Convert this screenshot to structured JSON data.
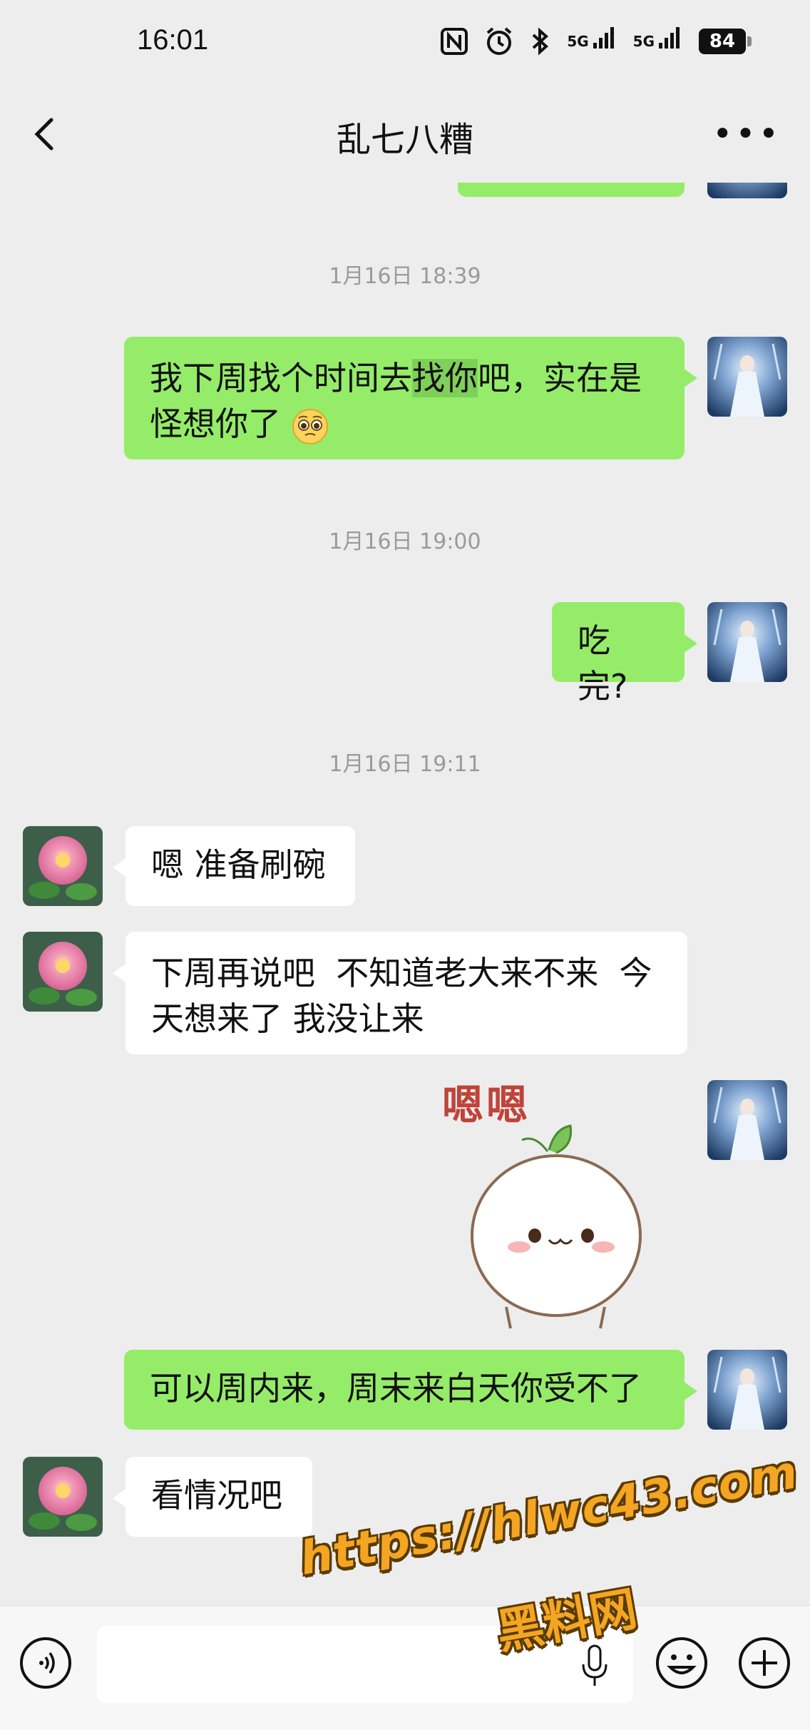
{
  "status": {
    "time": "16:01",
    "nfc_icon": "nfc-icon",
    "alarm_icon": "alarm-icon",
    "bluetooth_icon": "bluetooth-icon",
    "network1": "5G",
    "network2": "5G",
    "battery": "84"
  },
  "header": {
    "title": "乱七八糟",
    "back_icon": "chevron-left-icon",
    "more_icon": "more-icon"
  },
  "colors": {
    "outgoing": "#95ec69",
    "incoming": "#ffffff",
    "background": "#ededed",
    "watermark": "#f4a623"
  },
  "messages": [
    {
      "type": "timestamp",
      "text": "1月16日 18:39"
    },
    {
      "type": "out",
      "parts": [
        "我下周找个时间去",
        "找你",
        "吧，实在是",
        "怪想你了"
      ],
      "highlight_index": 1,
      "emoji": "pleading-face-emoji"
    },
    {
      "type": "timestamp",
      "text": "1月16日 19:00"
    },
    {
      "type": "out",
      "text": "吃完?"
    },
    {
      "type": "timestamp",
      "text": "1月16日 19:11"
    },
    {
      "type": "in",
      "text": "嗯 准备刷碗"
    },
    {
      "type": "in",
      "lines": [
        "下周再说吧  不知道老大来不来  今",
        "天想来了 我没让来"
      ]
    },
    {
      "type": "out_sticker",
      "caption": "嗯嗯",
      "sticker": "cute-bun-sticker"
    },
    {
      "type": "out",
      "text": "可以周内来，周末来白天你受不了"
    },
    {
      "type": "in",
      "text": "看情况吧"
    }
  ],
  "input": {
    "voice_icon": "voice-icon",
    "mic_icon": "mic-icon",
    "emoji_icon": "smile-icon",
    "add_icon": "plus-icon"
  },
  "watermark": {
    "url": "https://hlwc43.com",
    "name": "黑料网"
  }
}
